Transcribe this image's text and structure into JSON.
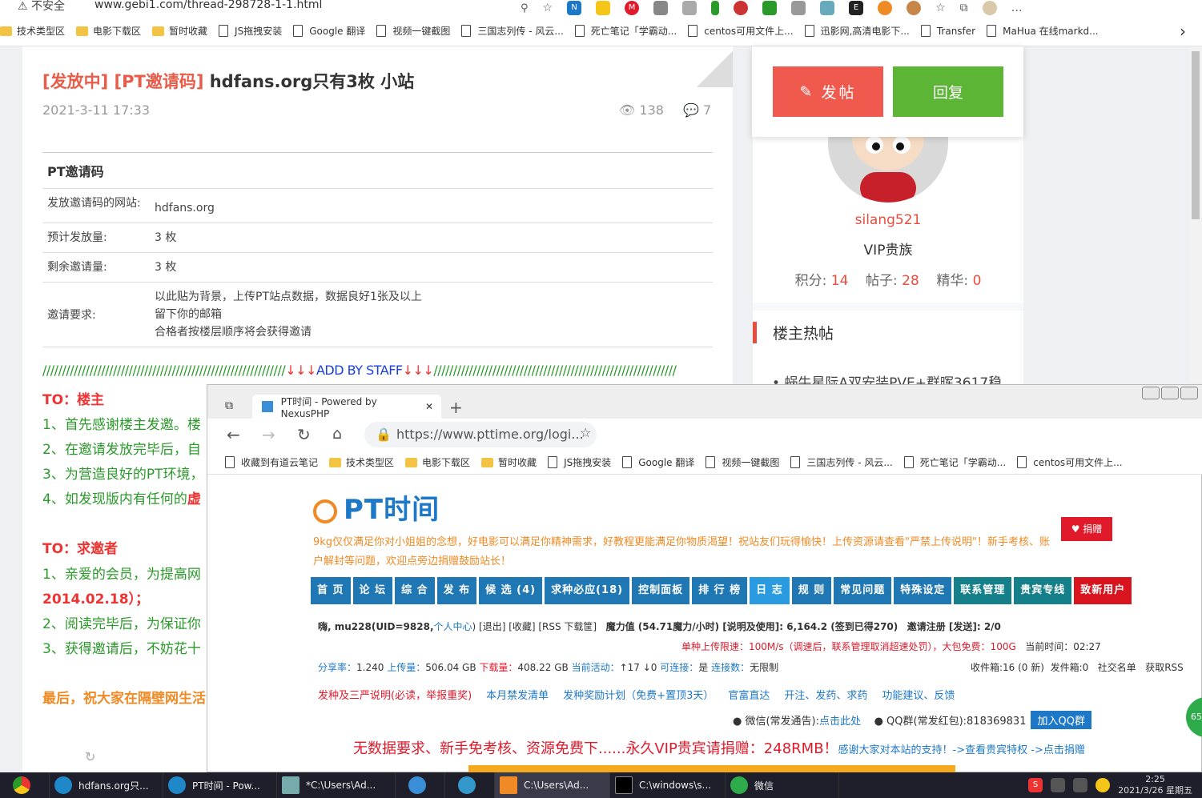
{
  "browser_top": {
    "security": "不安全",
    "url": "www.gebi1.com/thread-298728-1-1.html",
    "bookmarks": [
      {
        "label": "技术类型区",
        "type": "folder"
      },
      {
        "label": "电影下载区",
        "type": "folder"
      },
      {
        "label": "暂时收藏",
        "type": "folder"
      },
      {
        "label": "JS拖拽安装",
        "type": "page"
      },
      {
        "label": "Google 翻译",
        "type": "page"
      },
      {
        "label": "视频一键截图",
        "type": "page"
      },
      {
        "label": "三国志列传 - 风云...",
        "type": "page"
      },
      {
        "label": "死亡笔记「学霸动...",
        "type": "page"
      },
      {
        "label": "centos可用文件上...",
        "type": "page"
      },
      {
        "label": "迅影网,高清电影下...",
        "type": "page"
      },
      {
        "label": "Transfer",
        "type": "page"
      },
      {
        "label": "MaHua 在线markd...",
        "type": "page"
      }
    ]
  },
  "thread": {
    "title_prefix": "[发放中] [PT邀请码]",
    "title_main": "hdfans.org只有3枚 小站",
    "date": "2021-3-11 17:33",
    "views": "138",
    "comments": "7",
    "table_header": "PT邀请码",
    "rows": [
      {
        "key": "发放邀请码的网站:",
        "value": "hdfans.org"
      },
      {
        "key": "预计发放量:",
        "value": "3 枚"
      },
      {
        "key": "剩余邀请量:",
        "value": "3 枚"
      }
    ],
    "req_key": "邀请要求:",
    "req_lines": [
      "以此贴为背景，上传PT站点数据，数据良好1张及以上",
      "留下你的邮箱",
      "合格者按楼层顺序将会获得邀请"
    ],
    "staff_slashes_left": "//////////////////////////////////////////////////////////////",
    "staff_arrows": "↓↓↓",
    "staff_label": "ADD BY STAFF",
    "staff_slashes_right": "//////////////////////////////////////////////////////////////",
    "to_owner": "TO：楼主",
    "owner_lines": [
      "1、首先感谢楼主发邀。楼",
      "2、在邀请发放完毕后，自",
      "3、为营造良好的PT环境，",
      "4、如发现版内有任何的"
    ],
    "owner_line4_red": "虚",
    "to_seeker": "TO：求邀者",
    "seeker_lines": [
      "1、亲爱的会员，为提高网",
      "2014.02.18）；",
      "2、阅读完毕后，为保证你",
      "3、获得邀请后，不妨花十"
    ],
    "final_line": "最后，祝大家在隔壁网生活"
  },
  "popup": {
    "post_label": "发帖",
    "reply_label": "回复"
  },
  "profile": {
    "username": "silang521",
    "group": "VIP贵族",
    "points_label": "积分:",
    "points": "14",
    "posts_label": "帖子:",
    "posts": "28",
    "elite_label": "精华:",
    "elite": "0"
  },
  "hot": {
    "heading": "楼主热帖",
    "item1": "蜗牛星际A双安装PVE+群晖3617稳"
  },
  "browser2": {
    "tab_title": "PT时间 - Powered by NexusPHP",
    "url": "https://www.pttime.org/logi...",
    "bookmarks": [
      "收藏到有道云笔记",
      "技术类型区",
      "电影下载区",
      "暂时收藏",
      "JS拖拽安装",
      "Google 翻译",
      "视频一键截图",
      "三国志列传 - 风云...",
      "死亡笔记「学霸动...",
      "centos可用文件上..."
    ]
  },
  "pt": {
    "logo": "PT时间",
    "donate": "捐赠",
    "intro": "9kg仅仅满足你对小姐姐的念想，好电影可以满足你精神需求，好教程更能满足你物质渴望！祝站友们玩得愉快！上传资源请查看\"严禁上传说明\"！新手考核、账户解封等问题，欢迎点旁边捐赠鼓励站长！",
    "menu": [
      "首 页",
      "论 坛",
      "综 合",
      "发 布",
      "候 选 (4)",
      "求种必应(18)",
      "控制面板",
      "排 行 榜",
      "日 志",
      "规 则",
      "常见问题",
      "特殊设定",
      "联系管理",
      "贵宾专线",
      "致新用户"
    ],
    "info_hello": "嗨, mu228(UID=9828,",
    "info_center": "个人中心",
    "info_rest": ") [退出] [收藏] [RSS 下载筐]",
    "info_magic": "魔力值 (54.71魔力/小时) [说明及使用]: 6,164.2 (签到已得270)",
    "info_invite": "邀请注册 [发送]: 2/0",
    "info_limit": "单种上传限速：100M/s（调速后，联系管理取消超速处罚），大包免费：100G",
    "info_time": "当前时间：02:27",
    "share_ratio_label": "分享率：",
    "share_ratio": "1.240",
    "uploaded_label": "上传量：",
    "uploaded": "506.04 GB",
    "downloaded_label": "下载量：",
    "downloaded": "408.22 GB",
    "active_label": "当前活动：",
    "active": "↑17 ↓0",
    "connectable_label": "可连接：",
    "connectable": "是",
    "conns_label": "连接数：",
    "conns": "无限制",
    "inbox": "收件箱:16 (0 新)",
    "outbox": "发件箱:0",
    "social": "社交名单",
    "rss": "获取RSS",
    "links": [
      "发种及三严说明(必读，举报重奖)",
      "本月禁发清单",
      "发种奖励计划（免费+置顶3天）",
      "官富直达",
      "开注、发药、求药",
      "功能建议、反馈"
    ],
    "wechat": "微信(常发通告):",
    "wechat_link": "点击此处",
    "qq": "QQ群(常发红包):818369831",
    "qq_btn": "加入QQ群",
    "promo": "无数据要求、新手免考核、资源免费下......永久VIP贵宾请捐赠：248RMB！",
    "promo_small": "感谢大家对本站的支持！->查看贵宾特权 ->点击捐赠",
    "float": "65"
  },
  "taskbar": {
    "items": [
      "hdfans.org只...",
      "PT时间 - Pow...",
      "*C:\\Users\\Ad...",
      "",
      "",
      "C:\\Users\\Ad...",
      "C:\\windows\\s...",
      "微信"
    ],
    "time": "2:25",
    "date": "2021/3/26 星期五"
  },
  "colors": {
    "accent_red": "#e84c3d",
    "reply_green": "#5cb534",
    "pt_blue": "#1f77b4"
  }
}
